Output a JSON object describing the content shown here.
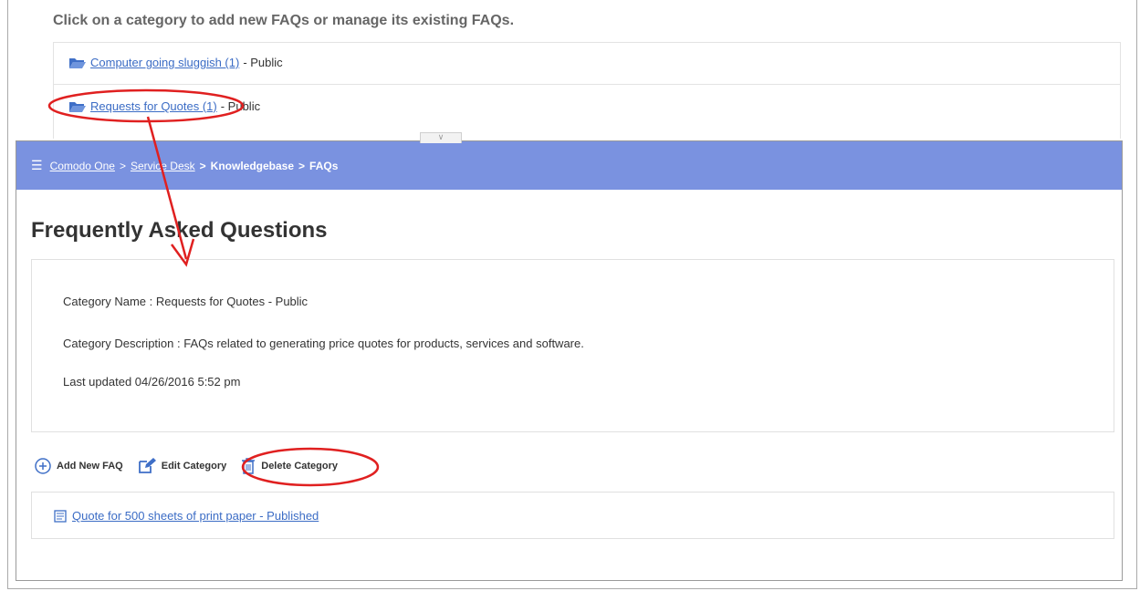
{
  "instruction": "Click on a category to add new FAQs or manage its existing FAQs.",
  "categories": [
    {
      "name": "Computer going sluggish (1)",
      "visibility": "- Public"
    },
    {
      "name": "Requests for Quotes (1)",
      "visibility": "- Public"
    }
  ],
  "handle": "∨",
  "breadcrumb": {
    "home": "Comodo One",
    "sep": ">",
    "section": "Service Desk",
    "kb": "Knowledgebase",
    "current": "FAQs"
  },
  "page_title": "Frequently Asked Questions",
  "category_info": {
    "name_line": "Category Name : Requests for Quotes - Public",
    "description_line": "Category Description : FAQs related to generating price quotes for products, services and software.",
    "updated_line": "Last updated 04/26/2016 5:52 pm"
  },
  "actions": {
    "add_faq": "Add New FAQ",
    "edit_category": "Edit Category",
    "delete_category": "Delete Category"
  },
  "faqs": [
    {
      "title": "Quote for 500 sheets of print paper - Published"
    }
  ],
  "colors": {
    "header_bar": "#7a92e0",
    "link": "#3b6cc5",
    "annotation": "#e02020",
    "icon_blue": "#3f6fc7"
  }
}
